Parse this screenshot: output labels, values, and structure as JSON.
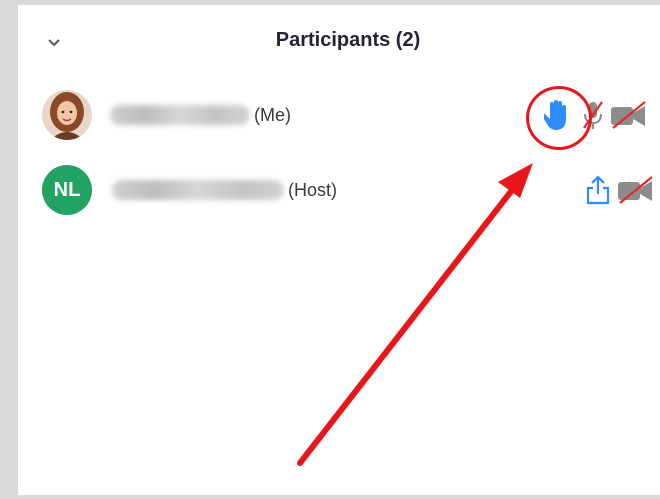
{
  "panel": {
    "title": "Participants (2)",
    "collapse_icon": "chevron-down-icon"
  },
  "participants": [
    {
      "name": "[blurred]",
      "role_suffix": "(Me)",
      "avatar": "photo",
      "status_icons": [
        "raised-hand-icon",
        "microphone-muted-icon",
        "video-off-icon"
      ]
    },
    {
      "name": "[blurred]",
      "avatar_initials": "NL",
      "role_suffix": "(Host)",
      "status_icons": [
        "share-screen-icon",
        "video-off-icon"
      ]
    }
  ],
  "colors": {
    "accent_blue": "#2d8cff",
    "muted_red": "#e02828",
    "avatar_green": "#23a363",
    "annotation_red": "#e8161b"
  }
}
